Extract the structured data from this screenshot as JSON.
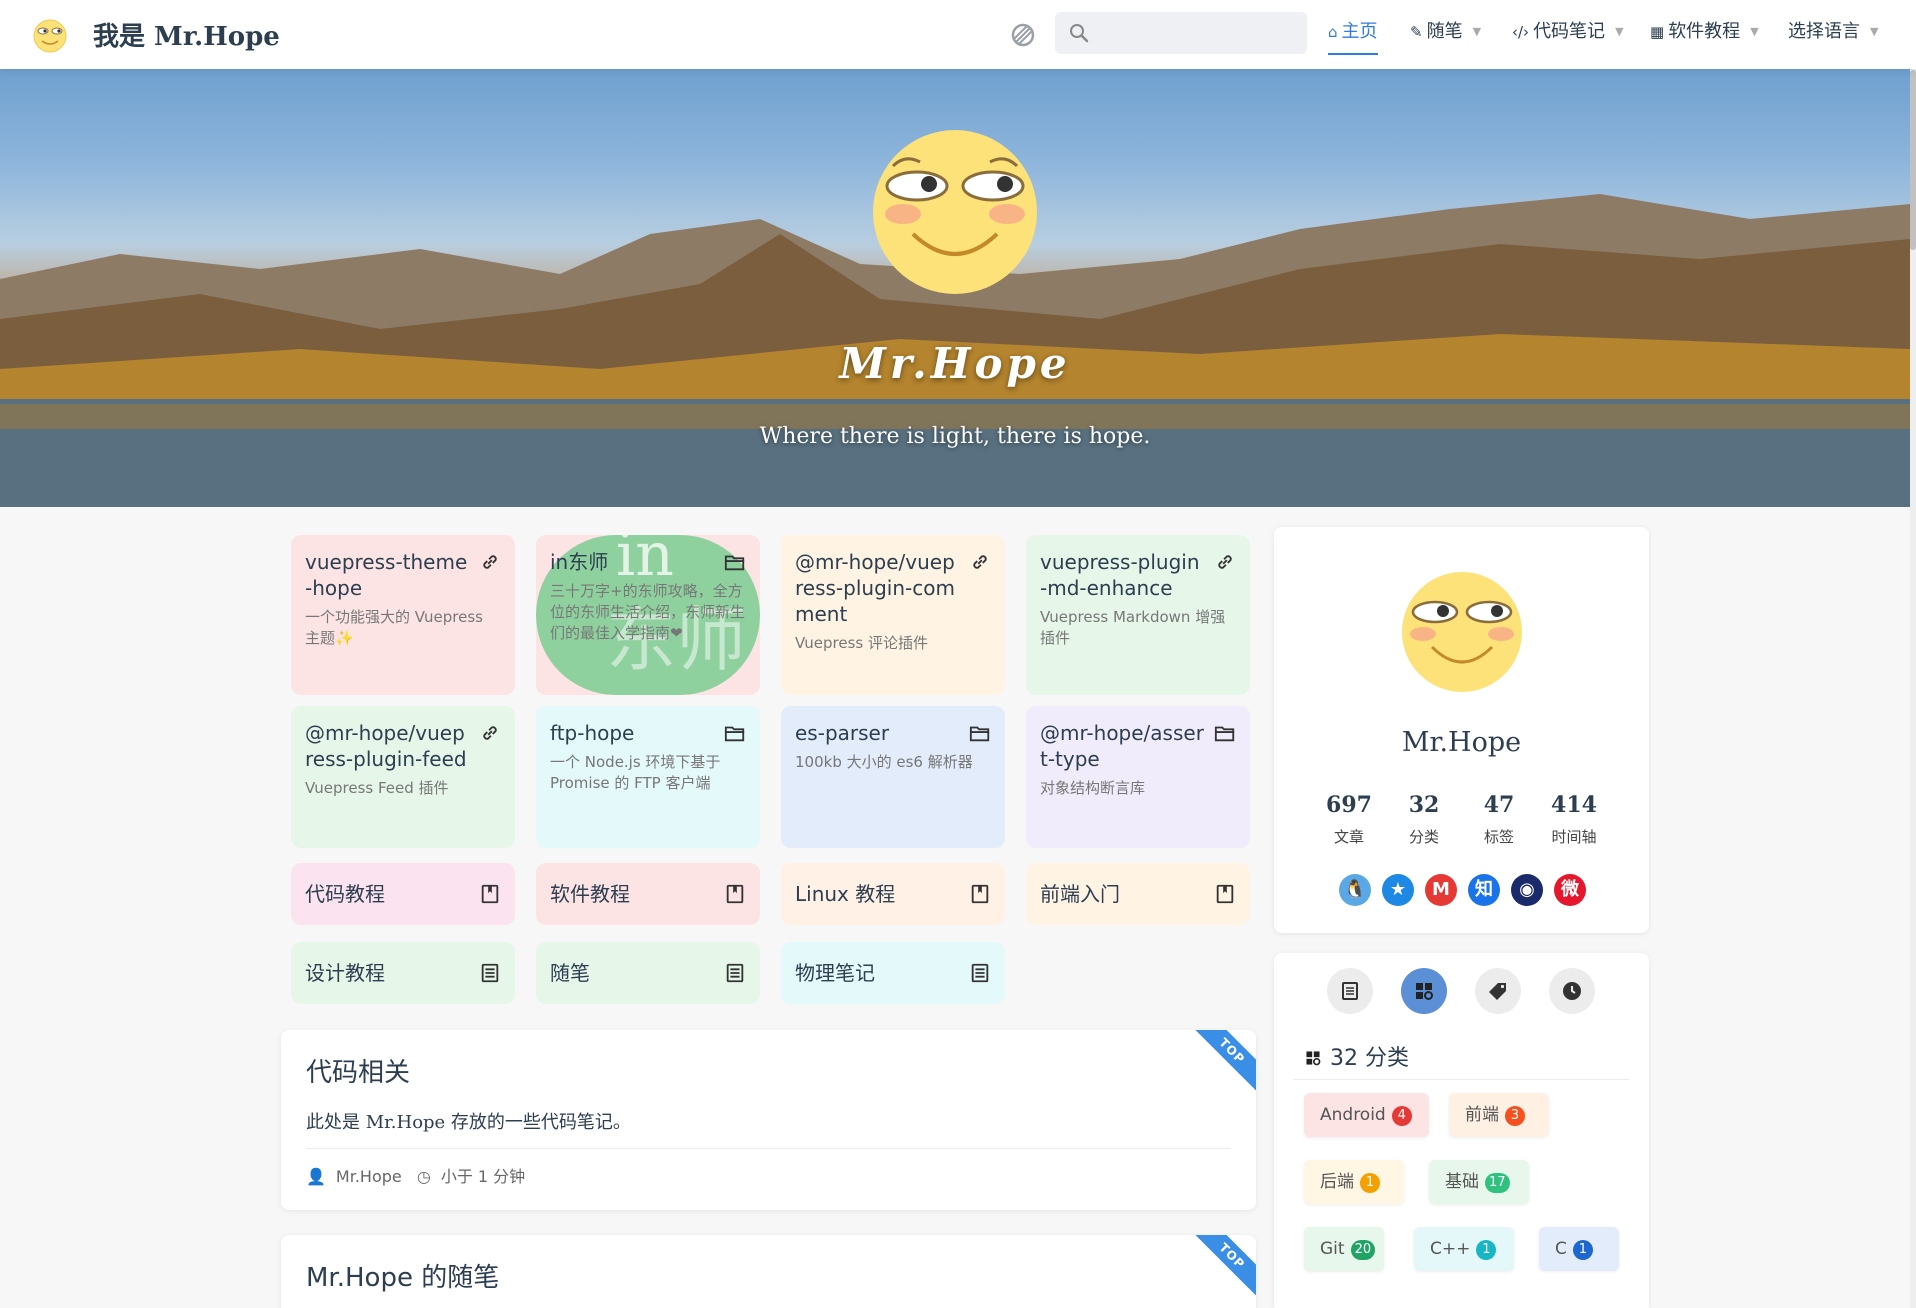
{
  "navbar": {
    "site_name": "我是 Mr.Hope",
    "search_placeholder": "",
    "items": [
      {
        "label": "主页",
        "icon": "home-icon"
      },
      {
        "label": "随笔",
        "icon": "note-icon"
      },
      {
        "label": "代码笔记",
        "icon": "code-icon"
      },
      {
        "label": "软件教程",
        "icon": "app-icon"
      },
      {
        "label": "选择语言",
        "icon": ""
      }
    ],
    "active_color": "#2e7be6"
  },
  "hero": {
    "title": "Mr.Hope",
    "subtitle": "Where there is light, there is hope."
  },
  "projects": [
    {
      "name": "vuepress-theme-hope",
      "desc": "一个功能强大的 Vuepress 主题✨",
      "icon": "link-icon",
      "color": "#fde4e4"
    },
    {
      "name": "in东师",
      "desc": "三十万字+的东师攻略，全方位的东师生活介绍，东师新生们的最佳入学指南❤",
      "icon": "folder-icon",
      "color": "#8fd19e"
    },
    {
      "name": "@mr-hope/vuepress-plugin-comment",
      "desc": "Vuepress 评论插件",
      "icon": "link-icon",
      "color": "#fff4e4"
    },
    {
      "name": "vuepress-plugin-md-enhance",
      "desc": "Vuepress Markdown 增强插件",
      "icon": "link-icon",
      "color": "#e6f7ea"
    },
    {
      "name": "@mr-hope/vuepress-plugin-feed",
      "desc": "Vuepress Feed 插件",
      "icon": "link-icon",
      "color": "#e6f7ea"
    },
    {
      "name": "ftp-hope",
      "desc": "一个 Node.js 环境下基于 Promise 的 FTP 客户端",
      "icon": "folder-icon",
      "color": "#e4f9fa"
    },
    {
      "name": "es-parser",
      "desc": "100kb 大小的 es6 解析器",
      "icon": "folder-icon",
      "color": "#e2ecfb"
    },
    {
      "name": "@mr-hope/assert-type",
      "desc": "对象结构断言库",
      "icon": "folder-icon",
      "color": "#f1ecfb"
    }
  ],
  "books": [
    {
      "name": "代码教程",
      "icon": "book-icon",
      "color": "#fbe4f0"
    },
    {
      "name": "软件教程",
      "icon": "book-icon",
      "color": "#fde4e4"
    },
    {
      "name": "Linux 教程",
      "icon": "book-icon",
      "color": "#fff1e6"
    },
    {
      "name": "前端入门",
      "icon": "book-icon",
      "color": "#fff4e4"
    },
    {
      "name": "设计教程",
      "icon": "article-icon",
      "color": "#e6f7ea"
    },
    {
      "name": "随笔",
      "icon": "article-icon",
      "color": "#e6f7ea"
    },
    {
      "name": "物理笔记",
      "icon": "article-icon",
      "color": "#e4f9fa"
    }
  ],
  "articles": [
    {
      "title": "代码相关",
      "excerpt": "此处是 Mr.Hope 存放的一些代码笔记。",
      "author": "Mr.Hope",
      "reading_time": "小于 1 分钟",
      "ribbon": "TOP"
    },
    {
      "title": "Mr.Hope 的随笔",
      "excerpt": "",
      "author": "",
      "reading_time": "",
      "ribbon": "TOP"
    }
  ],
  "profile": {
    "name": "Mr.Hope",
    "stats": [
      {
        "num": "697",
        "label": "文章"
      },
      {
        "num": "32",
        "label": "分类"
      },
      {
        "num": "47",
        "label": "标签"
      },
      {
        "num": "414",
        "label": "时间轴"
      }
    ],
    "socials": [
      {
        "name": "qq-icon",
        "glyph": "🐧",
        "color": "#5aa9e6"
      },
      {
        "name": "qzone-icon",
        "glyph": "★",
        "color": "#1e88e5"
      },
      {
        "name": "gmail-icon",
        "glyph": "M",
        "color": "#e53935"
      },
      {
        "name": "zhihu-icon",
        "glyph": "知",
        "color": "#1a73e8"
      },
      {
        "name": "steam-icon",
        "glyph": "◉",
        "color": "#1b2a6b"
      },
      {
        "name": "weibo-icon",
        "glyph": "微",
        "color": "#e6162d"
      }
    ]
  },
  "categories": {
    "header": "32 分类",
    "items": [
      {
        "name": "Android",
        "count": "4",
        "bg": "#fde4e4",
        "badge": "#e53935"
      },
      {
        "name": "前端",
        "count": "3",
        "bg": "#fff0e4",
        "badge": "#f4511e"
      },
      {
        "name": "后端",
        "count": "1",
        "bg": "#fff6e4",
        "badge": "#f5a000"
      },
      {
        "name": "基础",
        "count": "17",
        "bg": "#e8f7ec",
        "badge": "#2ec27e"
      },
      {
        "name": "Git",
        "count": "20",
        "bg": "#e8f7ec",
        "badge": "#21a366"
      },
      {
        "name": "C++",
        "count": "1",
        "bg": "#e4f8fa",
        "badge": "#17b6c4"
      },
      {
        "name": "C",
        "count": "1",
        "bg": "#e2ecfb",
        "badge": "#1e66d0"
      }
    ]
  }
}
